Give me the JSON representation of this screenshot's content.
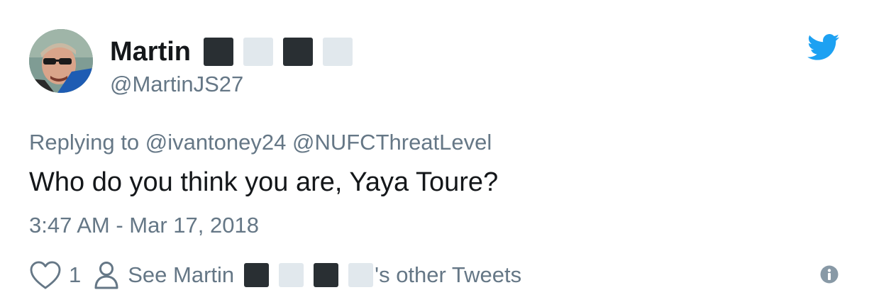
{
  "author": {
    "display_name": "Martin",
    "handle": "@MartinJS27",
    "avatar": "avatar-photo"
  },
  "brand": {
    "icon": "twitter-bird-icon",
    "color": "#1da1f2"
  },
  "tweet": {
    "replying_label": "Replying to",
    "mentions": [
      "@ivantoney24",
      "@NUFCThreatLevel"
    ],
    "text": "Who do you think you are, Yaya Toure?",
    "timestamp": "3:47 AM - Mar 17, 2018"
  },
  "actions": {
    "like_icon": "heart-icon",
    "like_count": "1",
    "profile_icon": "person-icon",
    "see_label": "See Martin",
    "others_label": "'s other Tweets",
    "info_icon": "info-icon"
  },
  "colors": {
    "primary_text": "#14171a",
    "secondary_text": "#657786",
    "emoji_dark": "#292f33",
    "emoji_light": "#e1e8ed"
  }
}
